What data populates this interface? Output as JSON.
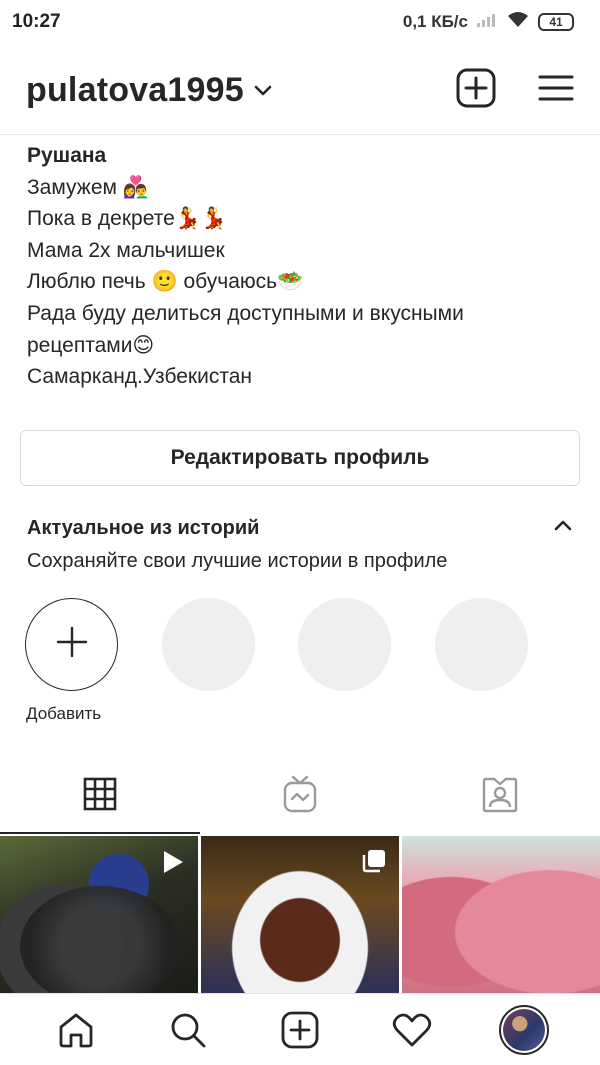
{
  "status_bar": {
    "time": "10:27",
    "network_speed": "0,1 КБ/с",
    "battery": "41"
  },
  "header": {
    "username": "pulatova1995"
  },
  "bio": {
    "name": "Рушана",
    "lines": [
      "Замужем 👩‍❤️‍👨",
      "Пока в декрете💃💃",
      "Мама 2х мальчишек",
      "Люблю печь 🙂 обучаюсь🥗",
      "Рада буду делиться доступными и вкусными",
      "рецептами😊",
      "Самарканд.Узбекистан"
    ]
  },
  "edit_profile_label": "Редактировать профиль",
  "highlights": {
    "title": "Актуальное из историй",
    "subtitle": "Сохраняйте свои лучшие истории в профиле",
    "add_label": "Добавить"
  },
  "tabs": [
    "grid-icon",
    "igtv-icon",
    "tagged-icon"
  ],
  "posts": [
    {
      "type": "video",
      "badge": "play-icon"
    },
    {
      "type": "carousel",
      "badge": "carousel-icon"
    },
    {
      "type": "photo",
      "badge": ""
    }
  ],
  "bottom_nav": [
    "home-icon",
    "search-icon",
    "new-post-icon",
    "activity-icon",
    "profile-avatar"
  ],
  "colors": {
    "text": "#262626",
    "border": "#dbdbdb",
    "placeholder": "#efefef"
  }
}
